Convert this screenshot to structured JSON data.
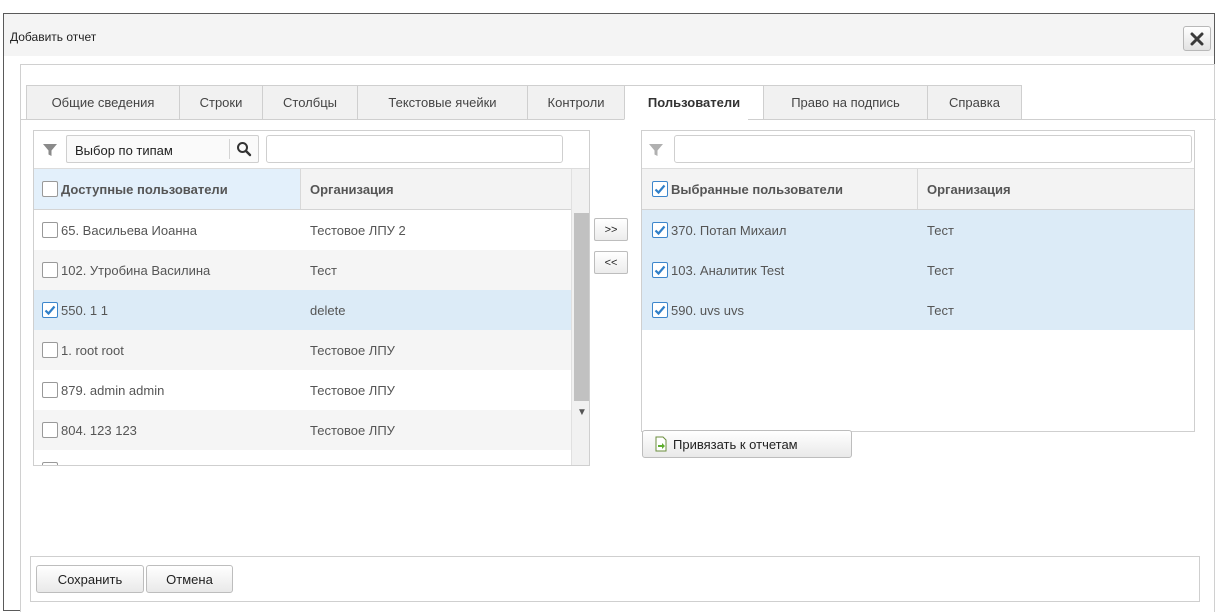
{
  "dialog": {
    "title": "Добавить отчет",
    "close_icon": "close-icon"
  },
  "tabs": [
    {
      "label": "Общие сведения"
    },
    {
      "label": "Строки"
    },
    {
      "label": "Столбцы"
    },
    {
      "label": "Текстовые ячейки"
    },
    {
      "label": "Контроли"
    },
    {
      "label": "Пользователи",
      "active": true
    },
    {
      "label": "Право на подпись"
    },
    {
      "label": "Справка"
    }
  ],
  "available": {
    "type_filter_label": "Выбор по типам",
    "search_value": "",
    "col_user": "Доступные пользователи",
    "col_org": "Организация",
    "rows": [
      {
        "user": "65. Васильева Иоанна",
        "org": "Тестовое ЛПУ 2",
        "checked": false
      },
      {
        "user": "102. Утробина Василина",
        "org": "Тест",
        "checked": false
      },
      {
        "user": "550. 1 1",
        "org": "delete",
        "checked": true
      },
      {
        "user": "1. root root",
        "org": "Тестовое ЛПУ",
        "checked": false
      },
      {
        "user": "879. admin admin",
        "org": "Тестовое ЛПУ",
        "checked": false
      },
      {
        "user": "804. 123 123",
        "org": "Тестовое ЛПУ",
        "checked": false
      }
    ]
  },
  "transfer": {
    "add_label": ">>",
    "remove_label": "<<"
  },
  "selected": {
    "search_value": "",
    "col_user": "Выбранные пользователи",
    "col_org": "Организация",
    "rows": [
      {
        "user": "370. Потап Михаил",
        "org": "Тест",
        "checked": true
      },
      {
        "user": "103. Аналитик Test",
        "org": "Тест",
        "checked": true
      },
      {
        "user": "590. uvs uvs",
        "org": "Тест",
        "checked": true
      }
    ]
  },
  "bind_button": {
    "label": "Привязать к отчетам",
    "icon": "document-arrow-icon"
  },
  "footer": {
    "save_label": "Сохранить",
    "cancel_label": "Отмена"
  },
  "colors": {
    "selected_row": "#dcebf7",
    "check": "#2f7fc8",
    "header_bg": "#f3f3f3"
  }
}
